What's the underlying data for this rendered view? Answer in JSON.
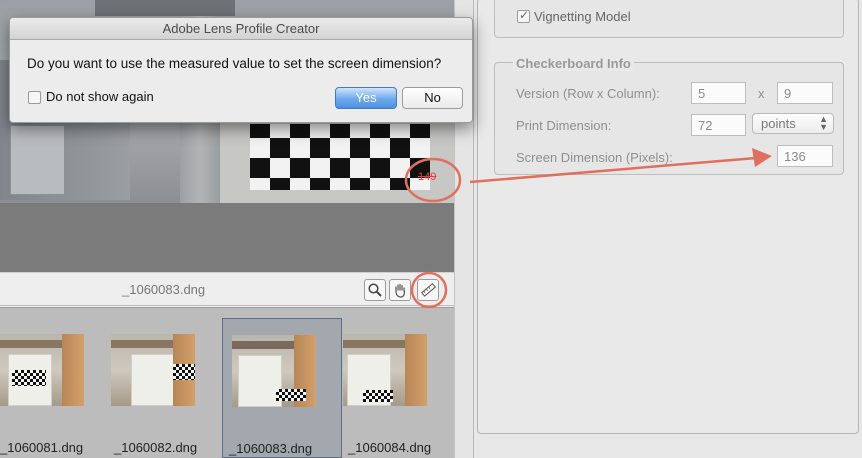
{
  "dialog": {
    "title": "Adobe Lens Profile Creator",
    "message": "Do you want to use the measured value to set the screen dimension?",
    "checkbox_label": "Do not show again",
    "checkbox_checked": false,
    "yes_label": "Yes",
    "no_label": "No"
  },
  "viewer": {
    "measure_readout": "149",
    "current_file": "_1060083.dng",
    "tools": [
      "zoom-icon",
      "hand-icon",
      "ruler-icon"
    ]
  },
  "filmstrip": {
    "items": [
      {
        "label": "_1060081.dng",
        "selected": false
      },
      {
        "label": "_1060082.dng",
        "selected": false
      },
      {
        "label": "_1060083.dng",
        "selected": true
      },
      {
        "label": "_1060084.dng",
        "selected": false
      }
    ]
  },
  "settings": {
    "vignetting_label": "Vignetting Model",
    "vignetting_checked": true,
    "checkerboard": {
      "title": "Checkerboard Info",
      "version_label": "Version (Row x Column):",
      "rows": "5",
      "x_label": "x",
      "columns": "9",
      "print_label": "Print Dimension:",
      "print_value": "72",
      "print_unit": "points",
      "screen_label": "Screen Dimension (Pixels):",
      "screen_value": "136"
    }
  },
  "colors": {
    "annotation_red": "#e0705e",
    "dialog_default_button": "#4b8fe3"
  }
}
